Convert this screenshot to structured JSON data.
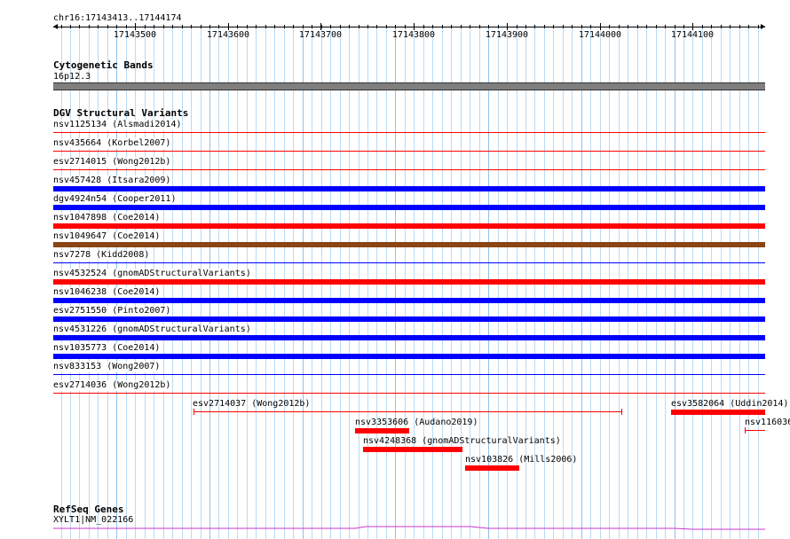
{
  "ruler": {
    "position": "chr16:17143413..17144174",
    "ticks": [
      "17143500",
      "17143600",
      "17143700",
      "17143800",
      "17143900",
      "17144000",
      "17144100"
    ]
  },
  "cytoband": {
    "title": "Cytogenetic Bands",
    "band": "16p12.3",
    "color": "#7f7f7f"
  },
  "dgv": {
    "title": "DGV Structural Variants",
    "colors": {
      "loss": "#ff0000",
      "gain": "#0000ff",
      "complex": "#8b4513"
    },
    "full_rows": [
      {
        "label": "nsv1125134 (Alsmadi2014)",
        "color": "#ff0000",
        "style": "thin"
      },
      {
        "label": "nsv435664 (Korbel2007)",
        "color": "#ff0000",
        "style": "thin"
      },
      {
        "label": "esv2714015 (Wong2012b)",
        "color": "#ff0000",
        "style": "thin"
      },
      {
        "label": "nsv457428 (Itsara2009)",
        "color": "#0000ff",
        "style": "thick"
      },
      {
        "label": "dgv4924n54 (Cooper2011)",
        "color": "#0000ff",
        "style": "thick"
      },
      {
        "label": "nsv1047898 (Coe2014)",
        "color": "#ff0000",
        "style": "thick"
      },
      {
        "label": "nsv1049647 (Coe2014)",
        "color": "#8b4513",
        "style": "thick"
      },
      {
        "label": "nsv7278 (Kidd2008)",
        "color": "#0000ff",
        "style": "thin"
      },
      {
        "label": "nsv4532524 (gnomADStructuralVariants)",
        "color": "#ff0000",
        "style": "thick"
      },
      {
        "label": "nsv1046238 (Coe2014)",
        "color": "#0000ff",
        "style": "thick"
      },
      {
        "label": "esv2751550 (Pinto2007)",
        "color": "#0000ff",
        "style": "thick"
      },
      {
        "label": "nsv4531226 (gnomADStructuralVariants)",
        "color": "#0000ff",
        "style": "thick"
      },
      {
        "label": "nsv1035773 (Coe2014)",
        "color": "#0000ff",
        "style": "thick"
      },
      {
        "label": "nsv833153 (Wong2007)",
        "color": "#0000ff",
        "style": "thin"
      },
      {
        "label": "esv2714036 (Wong2012b)",
        "color": "#ff0000",
        "style": "thin"
      }
    ],
    "partial": [
      {
        "label": "esv2714037 (Wong2012b)",
        "color": "#ff0000",
        "style": "thin"
      },
      {
        "label": "esv3582064 (Uddin2014)",
        "color": "#ff0000",
        "style": "thick"
      },
      {
        "label": "nsv3353606 (Audano2019)",
        "color": "#ff0000",
        "style": "thick"
      },
      {
        "label": "nsv116036",
        "color": "#ff0000",
        "style": "thin"
      },
      {
        "label": "nsv4248368 (gnomADStructuralVariants)",
        "color": "#ff0000",
        "style": "thick"
      },
      {
        "label": "nsv103826 (Mills2006)",
        "color": "#ff0000",
        "style": "thick"
      }
    ]
  },
  "refseq": {
    "title": "RefSeq Genes",
    "gene": "XYLT1|NM_022166",
    "color": "#cc33cc"
  }
}
